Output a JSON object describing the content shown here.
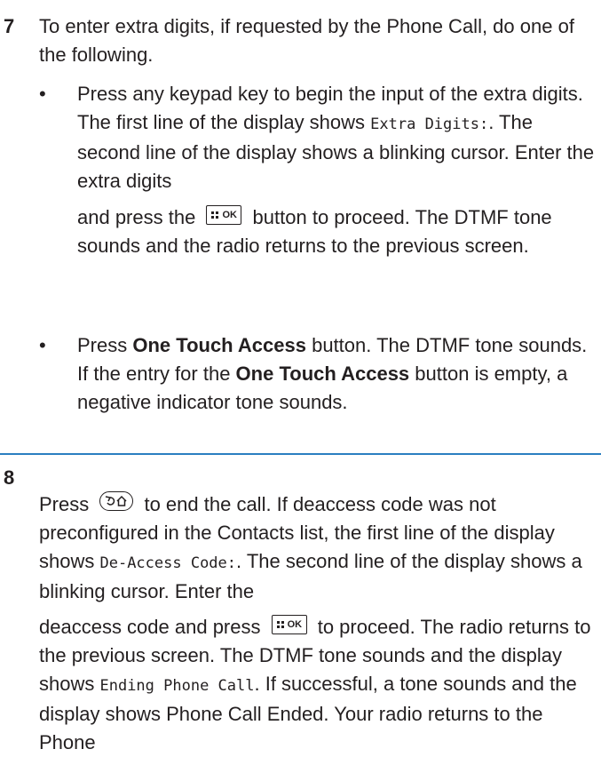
{
  "step7": {
    "number": "7",
    "intro": "To enter extra digits, if requested by the Phone Call, do one of the following.",
    "bullet1": {
      "part1": "Press any keypad key to begin the input of the extra digits. The first line of the display shows ",
      "display_extra": "Extra Digits:",
      "part2": ". The second line of the display shows a blinking cursor. Enter the extra digits",
      "part3": "and press the ",
      "part4": " button to proceed. The DTMF tone sounds and the radio returns to the previous screen."
    },
    "bullet2": {
      "part1": "Press ",
      "bold1": "One Touch Access",
      "part2": " button. The DTMF tone sounds. If the entry for the ",
      "bold2": "One Touch Access",
      "part3": " button is empty, a negative indicator tone sounds."
    },
    "bullet_char": "•"
  },
  "step8": {
    "number": "8",
    "part1": "Press ",
    "part2": " to end the call. If deaccess code was not preconfigured in the Contacts list, the first line of the display shows ",
    "display_deaccess": "De-Access Code:",
    "part3": ". The second line of the display shows a blinking cursor. Enter the",
    "part4": "deaccess code and press ",
    "part5": " to proceed. The radio returns to the previous screen. The DTMF tone sounds and the display shows ",
    "display_ending": "Ending Phone Call",
    "part6": ". If successful, a tone sounds and the display shows Phone Call Ended. Your radio returns to the Phone"
  },
  "keys": {
    "ok_icon": "menu-ok-key-icon",
    "ok_label": "OK",
    "back_icon": "back-home-key-icon"
  },
  "colors": {
    "text": "#231f20",
    "divider": "#2a7fc1"
  }
}
